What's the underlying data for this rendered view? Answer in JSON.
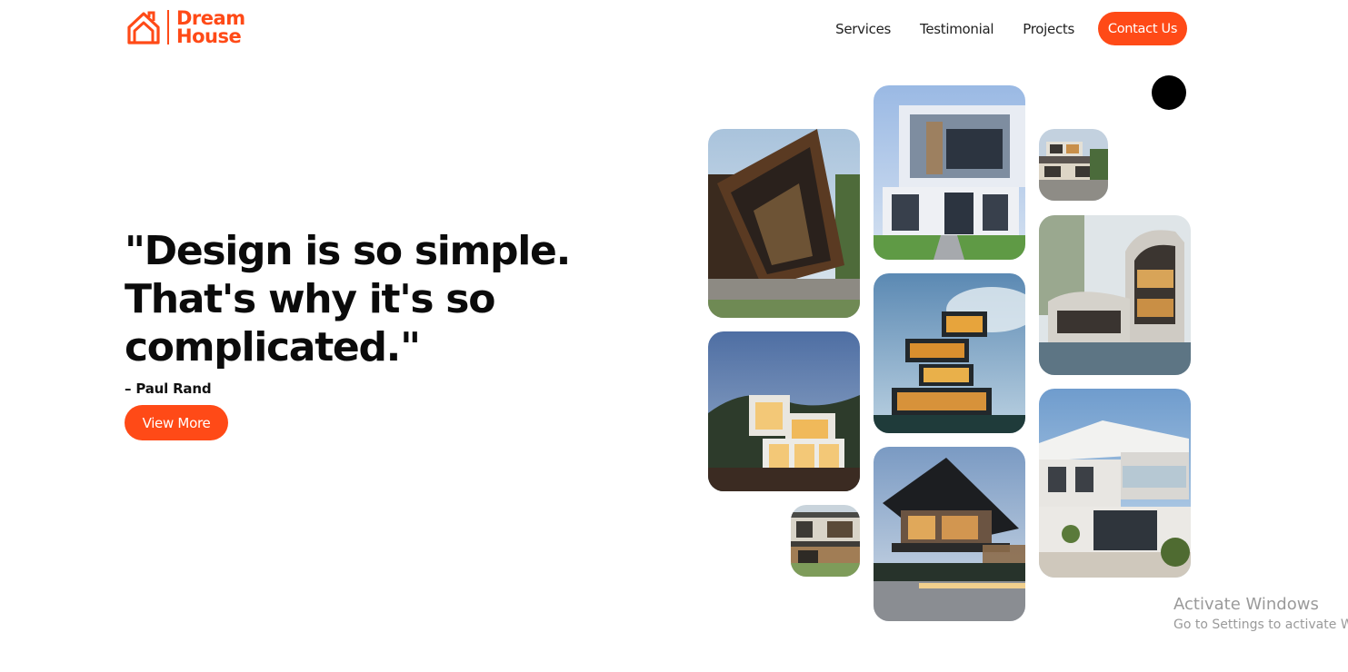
{
  "brand": {
    "line1": "Dream",
    "line2": "House"
  },
  "nav": {
    "items": [
      "Services",
      "Testimonial",
      "Projects"
    ],
    "contact_label": "Contact Us"
  },
  "hero": {
    "quote_line1": "\"Design is so simple.",
    "quote_line2": "That's why it's so",
    "quote_line3": "complicated.\"",
    "author": "– Paul Rand",
    "cta_label": "View More"
  },
  "gallery": {
    "tiles": [
      {
        "icon": "house-photo-angular-wood"
      },
      {
        "icon": "house-photo-white-cube"
      },
      {
        "icon": "house-photo-small-hillside"
      },
      {
        "icon": "house-photo-curved-villa"
      },
      {
        "icon": "house-photo-stacked-boxes"
      },
      {
        "icon": "house-photo-glass-boxes-dusk"
      },
      {
        "icon": "house-photo-cantilever-dark"
      },
      {
        "icon": "house-photo-white-modern-balcony"
      },
      {
        "icon": "house-photo-small-terrace"
      }
    ]
  },
  "watermark": {
    "title": "Activate Windows",
    "subtitle": "Go to Settings to activate Windows."
  },
  "colors": {
    "accent": "#ff4a17",
    "text": "#0b0b0b",
    "background": "#ffffff"
  }
}
